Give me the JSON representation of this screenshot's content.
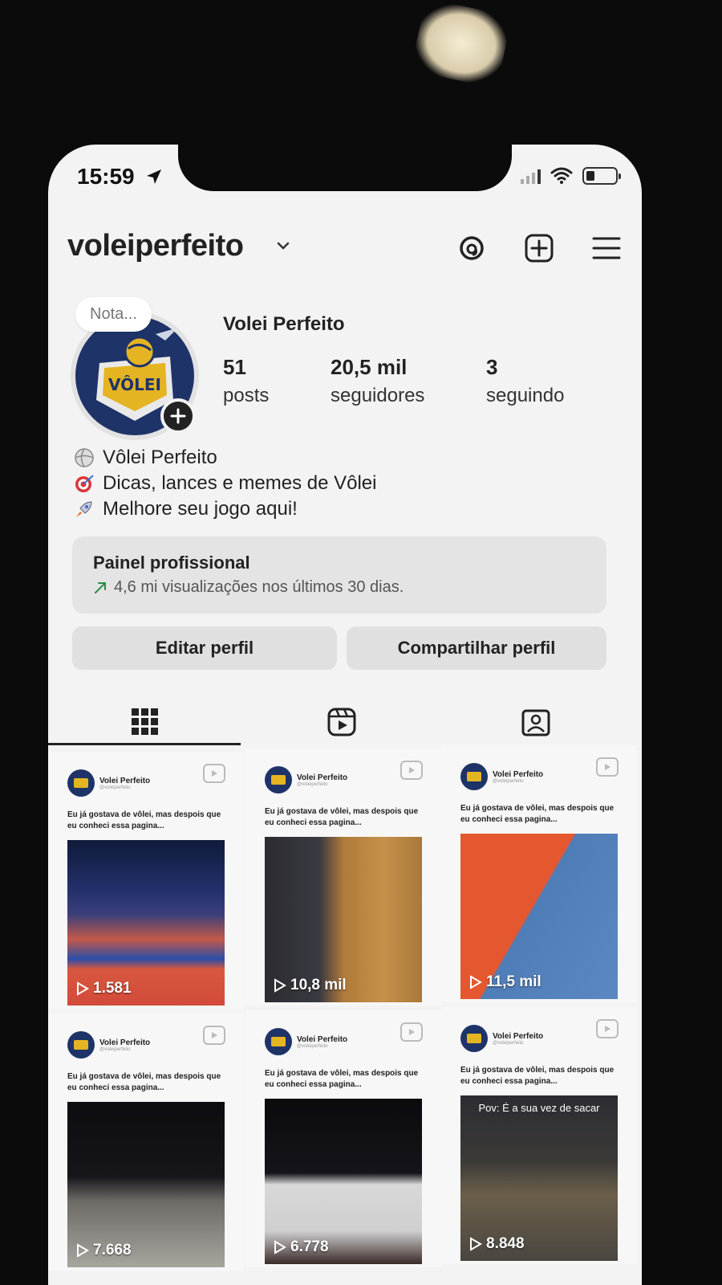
{
  "status_bar": {
    "time": "15:59"
  },
  "header": {
    "username": "voleiperfeito"
  },
  "profile": {
    "note_placeholder": "Nota...",
    "display_name": "Volei Perfeito",
    "stats": [
      {
        "num": "51",
        "label": "posts"
      },
      {
        "num": "20,5 mil",
        "label": "seguidores"
      },
      {
        "num": "3",
        "label": "seguindo"
      }
    ],
    "bio": [
      {
        "emoji": "volleyball-icon",
        "text": "Vôlei Perfeito"
      },
      {
        "emoji": "target-icon",
        "text": "Dicas, lances e memes de Vôlei"
      },
      {
        "emoji": "rocket-icon",
        "text": "Melhore seu jogo aqui!"
      }
    ]
  },
  "panel": {
    "title": "Painel profissional",
    "subtitle": "4,6 mi visualizações nos últimos 30 dias."
  },
  "buttons": {
    "edit": "Editar perfil",
    "share": "Compartilhar perfil"
  },
  "posts": [
    {
      "author": "Volei Perfeito",
      "handle": "@voleiperfeito",
      "caption": "Eu já gostava de vôlei, mas despois que eu conheci essa pagina...",
      "views": "1.581",
      "overlay": ""
    },
    {
      "author": "Volei Perfeito",
      "handle": "@voleiperfeito",
      "caption": "Eu já gostava de vôlei, mas despois que eu conheci essa pagina...",
      "views": "10,8 mil",
      "overlay": ""
    },
    {
      "author": "Volei Perfeito",
      "handle": "@voleiperfeito",
      "caption": "Eu já gostava de vôlei, mas despois que eu conheci essa pagina...",
      "views": "11,5 mil",
      "overlay": ""
    },
    {
      "author": "Volei Perfeito",
      "handle": "@voleiperfeito",
      "caption": "Eu já gostava de vôlei, mas despois que eu conheci essa pagina...",
      "views": "7.668",
      "overlay": ""
    },
    {
      "author": "Volei Perfeito",
      "handle": "@voleiperfeito",
      "caption": "Eu já gostava de vôlei, mas despois que eu conheci essa pagina...",
      "views": "6.778",
      "overlay": ""
    },
    {
      "author": "Volei Perfeito",
      "handle": "@voleiperfeito",
      "caption": "Eu já gostava de vôlei, mas despois que eu conheci essa pagina...",
      "views": "8.848",
      "overlay": "Pov: É a sua vez de sacar"
    }
  ],
  "colors": {
    "screen_bg": "#f3f3f3",
    "text": "#222222",
    "button_bg": "#e0e0e0",
    "avatar_navy": "#1e3468",
    "avatar_gold": "#e5b422"
  }
}
